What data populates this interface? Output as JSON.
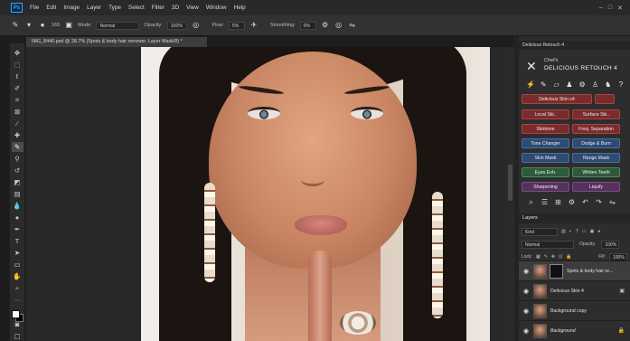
{
  "menu": {
    "logo": "Ps",
    "items": [
      "File",
      "Edit",
      "Image",
      "Layer",
      "Type",
      "Select",
      "Filter",
      "3D",
      "View",
      "Window",
      "Help"
    ]
  },
  "options": {
    "brush_size": "165",
    "mode_label": "Mode:",
    "mode_value": "Normal",
    "opacity_label": "Opacity:",
    "opacity_value": "100%",
    "flow_label": "Flow:",
    "flow_value": "5%",
    "smoothing_label": "Smoothing:",
    "smoothing_value": "0%"
  },
  "document": {
    "tab_title": "IMG_8446.psd @ 28.7% (Spots & body hair remover, Layer Mask/8) *"
  },
  "plugin": {
    "panel_title": "Delicious Retouch 4",
    "logo_small": "Chef's",
    "logo_big": "DELICIOUS RETOUCH 4",
    "buttons": {
      "delicious_skin": "Delicious Skin v4",
      "local_skin": "Local Ski..",
      "surface_skin": "Surface Ski..",
      "skintone": "Skintone",
      "freq_sep": "Freq. Separation",
      "tone_changer": "Tone Changer",
      "dodge_burn": "Dodge & Burn",
      "skin_mask": "Skin Mask",
      "range_mask": "Range Mask",
      "eyes_enh": "Eyes Enh.",
      "whiten_teeth": "Whiten Teeth",
      "sharpening": "Sharpening",
      "liquify": "Liquify"
    }
  },
  "layers": {
    "tab_label": "Layers",
    "kind_label": "Kind",
    "blend_mode": "Normal",
    "opacity_label": "Opacity:",
    "opacity_value": "100%",
    "lock_label": "Lock:",
    "fill_label": "Fill:",
    "fill_value": "100%",
    "items": [
      {
        "name": "Spots & body hair re..."
      },
      {
        "name": "Delicious Skin 4"
      },
      {
        "name": "Background copy"
      },
      {
        "name": "Background"
      }
    ]
  }
}
